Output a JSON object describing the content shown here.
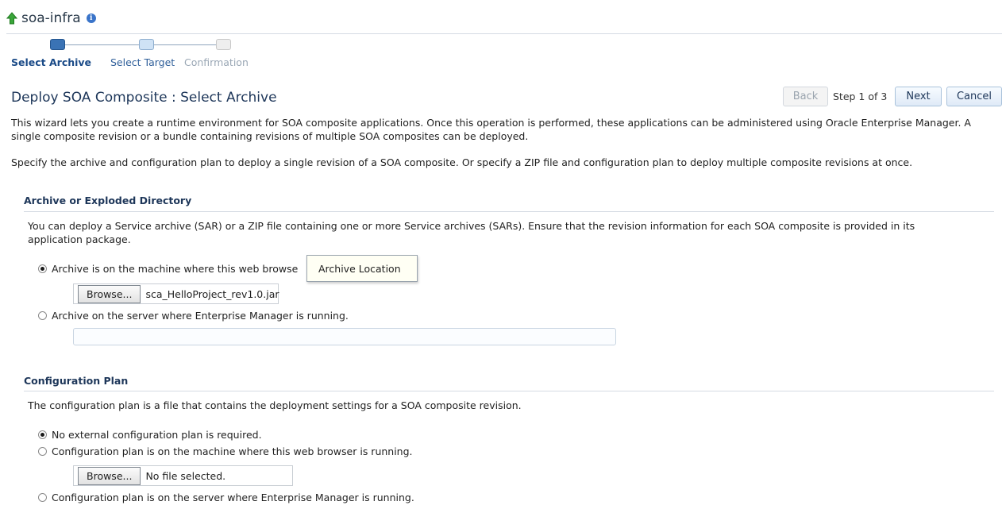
{
  "header": {
    "title": "soa-infra",
    "up_icon": "up-arrow-icon",
    "info_icon": "info-icon"
  },
  "train": {
    "steps": [
      {
        "label": "Select Archive",
        "state": "current"
      },
      {
        "label": "Select Target",
        "state": "next"
      },
      {
        "label": "Confirmation",
        "state": "disabled"
      }
    ]
  },
  "page": {
    "title": "Deploy SOA Composite : Select Archive",
    "back_label": "Back",
    "step_text": "Step 1 of 3",
    "next_label": "Next",
    "cancel_label": "Cancel",
    "intro1": "This wizard lets you create a runtime environment for SOA composite applications. Once this operation is performed, these applications can be administered using Oracle Enterprise Manager. A single composite revision or a bundle containing revisions of multiple SOA composites can be deployed.",
    "intro2": "Specify the archive and configuration plan to deploy a single revision of a SOA composite. Or specify a ZIP file and configuration plan to deploy multiple composite revisions at once."
  },
  "archive": {
    "heading": "Archive or Exploded Directory",
    "desc": "You can deploy a Service archive (SAR) or a ZIP file containing one or more Service archives (SARs). Ensure that the revision information for each SOA composite is provided in its application package.",
    "opt_local": "Archive is on the machine where this web browse",
    "opt_local_selected": true,
    "browse_label": "Browse...",
    "file_name": "sca_HelloProject_rev1.0.jar",
    "opt_server": "Archive on the server where Enterprise Manager is running.",
    "server_path": "",
    "tooltip": "Archive Location"
  },
  "plan": {
    "heading": "Configuration Plan",
    "desc": "The configuration plan is a file that contains the deployment settings for a SOA composite revision.",
    "opt_none": "No external configuration plan is required.",
    "opt_local": "Configuration plan is on the machine where this web browser is running.",
    "browse_label": "Browse...",
    "file_name": "No file selected.",
    "opt_server": "Configuration plan is on the server where Enterprise Manager is running.",
    "selected": "none"
  },
  "colors": {
    "accent": "#1d3659",
    "train_current": "#3a73b5"
  }
}
